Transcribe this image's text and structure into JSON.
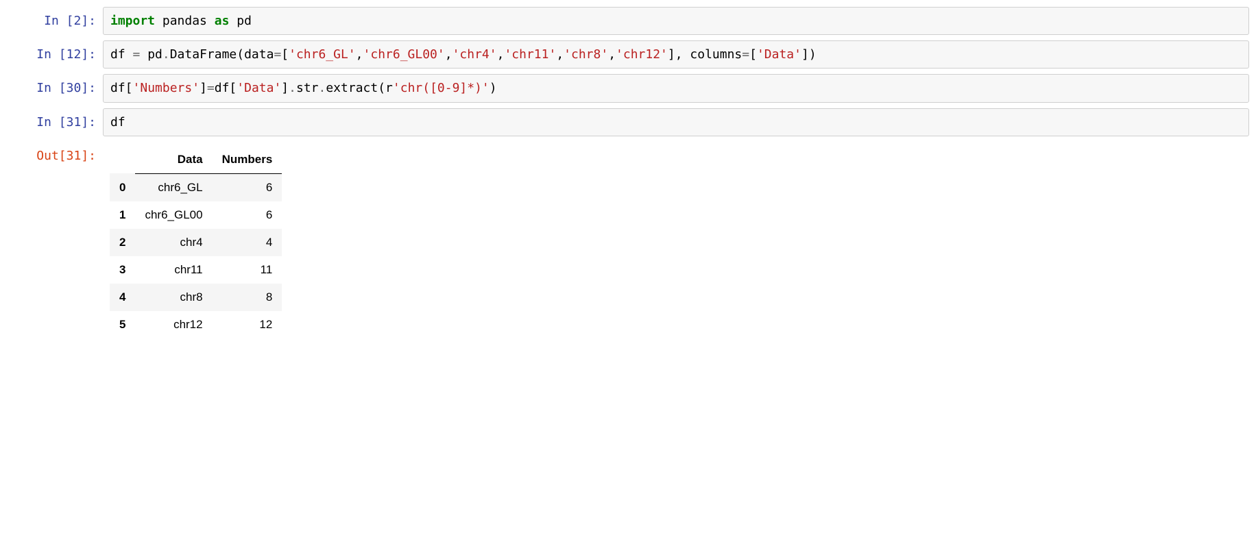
{
  "cells": {
    "c0": {
      "in_prompt": "In [2]:",
      "tokens": {
        "t0": "import",
        "t1": " pandas ",
        "t2": "as",
        "t3": " pd"
      }
    },
    "c1": {
      "in_prompt": "In [12]:",
      "tokens": {
        "t0": "df ",
        "t1": "=",
        "t2": " pd",
        "t3": ".",
        "t4": "DataFrame(data",
        "t5": "=",
        "t6": "[",
        "t7": "'chr6_GL'",
        "t8": ",",
        "t9": "'chr6_GL00'",
        "t10": ",",
        "t11": "'chr4'",
        "t12": ",",
        "t13": "'chr11'",
        "t14": ",",
        "t15": "'chr8'",
        "t16": ",",
        "t17": "'chr12'",
        "t18": "], columns",
        "t19": "=",
        "t20": "[",
        "t21": "'Data'",
        "t22": "])"
      }
    },
    "c2": {
      "in_prompt": "In [30]:",
      "tokens": {
        "t0": "df[",
        "t1": "'Numbers'",
        "t2": "]",
        "t3": "=",
        "t4": "df[",
        "t5": "'Data'",
        "t6": "]",
        "t7": ".",
        "t8": "str",
        "t9": ".",
        "t10": "extract(r",
        "t11": "'chr([0-9]*)'",
        "t12": ")"
      }
    },
    "c3": {
      "in_prompt": "In [31]:",
      "out_prompt": "Out[31]:",
      "tokens": {
        "t0": "df"
      }
    }
  },
  "dataframe": {
    "columns": [
      "Data",
      "Numbers"
    ],
    "index": [
      "0",
      "1",
      "2",
      "3",
      "4",
      "5"
    ],
    "rows": [
      {
        "idx": "0",
        "Data": "chr6_GL",
        "Numbers": "6"
      },
      {
        "idx": "1",
        "Data": "chr6_GL00",
        "Numbers": "6"
      },
      {
        "idx": "2",
        "Data": "chr4",
        "Numbers": "4"
      },
      {
        "idx": "3",
        "Data": "chr11",
        "Numbers": "11"
      },
      {
        "idx": "4",
        "Data": "chr8",
        "Numbers": "8"
      },
      {
        "idx": "5",
        "Data": "chr12",
        "Numbers": "12"
      }
    ]
  }
}
